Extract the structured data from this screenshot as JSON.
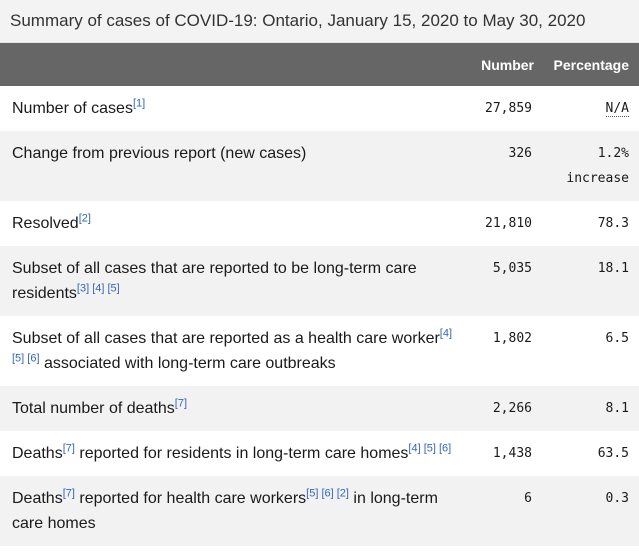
{
  "caption": "Summary of cases of COVID-19: Ontario, January 15, 2020 to May 30, 2020",
  "header": {
    "label": "",
    "number": "Number",
    "percentage": "Percentage"
  },
  "rows": [
    {
      "label": "Number of cases",
      "refs": "[1]",
      "number": "27,859",
      "percentage": "N/A"
    },
    {
      "label": "Change from previous report (new cases)",
      "number": "326",
      "percentage": "1.2%",
      "percentage_sub": "increase"
    },
    {
      "label": "Resolved",
      "refs": "[2]",
      "number": "21,810",
      "percentage": "78.3"
    },
    {
      "label": "Subset of all cases that are reported to be long-term care residents",
      "refs": "[3] [4] [5]",
      "number": "5,035",
      "percentage": "18.1"
    },
    {
      "label_pre": "Subset of all cases that are reported as a health care worker",
      "refs": "[4] [5] [6]",
      "label_post": " associated with long-term care outbreaks",
      "number": "1,802",
      "percentage": "6.5"
    },
    {
      "label": "Total number of deaths",
      "refs": "[7]",
      "number": "2,266",
      "percentage": "8.1"
    },
    {
      "label_pre": "Deaths",
      "refs_a": "[7]",
      "label_mid": " reported for residents in long-term care homes",
      "refs_b": "[4] [5] [6]",
      "number": "1,438",
      "percentage": "63.5"
    },
    {
      "label_pre": "Deaths",
      "refs_a": "[7]",
      "label_mid": " reported for health care workers",
      "refs_b": "[5] [6] [2]",
      "label_post": " in long-term care homes",
      "number": "6",
      "percentage": "0.3"
    }
  ]
}
